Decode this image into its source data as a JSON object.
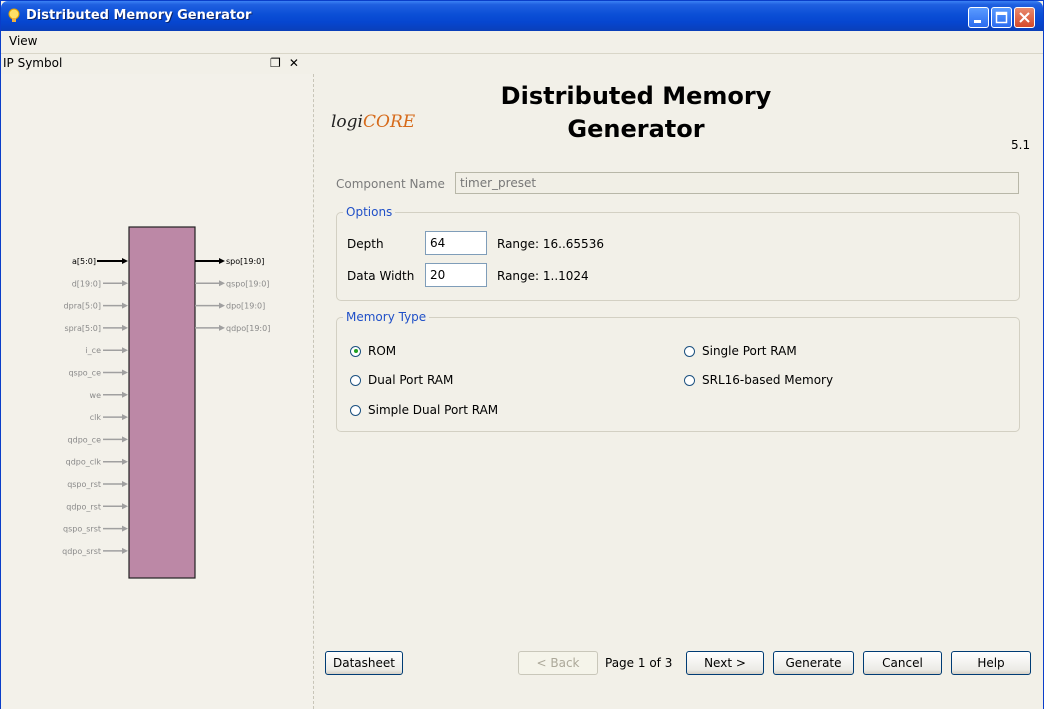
{
  "window": {
    "title": "Distributed Memory Generator"
  },
  "menu": {
    "view": "View"
  },
  "ip_symbol": {
    "title": "IP Symbol",
    "buttons": "❐ ✕",
    "inputs": [
      "a[5:0]",
      "d[19:0]",
      "dpra[5:0]",
      "spra[5:0]",
      "i_ce",
      "qspo_ce",
      "we",
      "clk",
      "qdpo_ce",
      "qdpo_clk",
      "qspo_rst",
      "qdpo_rst",
      "qspo_srst",
      "qdpo_srst"
    ],
    "outputs": [
      "spo[19:0]",
      "qspo[19:0]",
      "dpo[19:0]",
      "qdpo[19:0]"
    ]
  },
  "header": {
    "logo_logi": "logi",
    "logo_core": "CORE",
    "title_line1": "Distributed Memory",
    "title_line2": "Generator",
    "version": "5.1"
  },
  "component": {
    "label": "Component Name",
    "value": "timer_preset"
  },
  "options": {
    "legend": "Options",
    "depth_label": "Depth",
    "depth_value": "64",
    "depth_range": "Range: 16..65536",
    "width_label": "Data Width",
    "width_value": "20",
    "width_range": "Range: 1..1024"
  },
  "memory_type": {
    "legend": "Memory Type",
    "rom": "ROM",
    "single_port_ram": "Single Port RAM",
    "dual_port_ram": "Dual Port RAM",
    "srl16": "SRL16-based Memory",
    "simple_dual_port_ram": "Simple Dual Port RAM",
    "selected": "ROM"
  },
  "footer": {
    "datasheet": "Datasheet",
    "back": "< Back",
    "page_info": "Page 1 of 3",
    "next": "Next >",
    "generate": "Generate",
    "cancel": "Cancel",
    "help": "Help"
  },
  "colors": {
    "title_bar": "#0b4fd6",
    "symbol_fill": "#bc88a6",
    "legend": "#2050c8"
  }
}
